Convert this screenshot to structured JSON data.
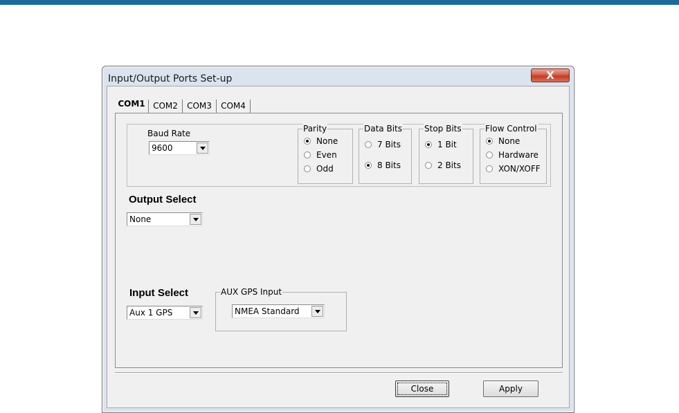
{
  "window": {
    "title": "Input/Output Ports Set-up",
    "close_glyph": "X"
  },
  "tabs": [
    {
      "label": "COM1",
      "active": true
    },
    {
      "label": "COM2",
      "active": false
    },
    {
      "label": "COM3",
      "active": false
    },
    {
      "label": "COM4",
      "active": false
    }
  ],
  "baud": {
    "label": "Baud Rate",
    "value": "9600"
  },
  "parity": {
    "legend": "Parity",
    "options": [
      "None",
      "Even",
      "Odd"
    ],
    "selected": "None"
  },
  "data_bits": {
    "legend": "Data Bits",
    "options": [
      "7 Bits",
      "8 Bits"
    ],
    "selected": "8 Bits"
  },
  "stop_bits": {
    "legend": "Stop Bits",
    "options": [
      "1 Bit",
      "2 Bits"
    ],
    "selected": "1 Bit"
  },
  "flow_control": {
    "legend": "Flow Control",
    "options": [
      "None",
      "Hardware",
      "XON/XOFF"
    ],
    "selected": "None"
  },
  "output_select": {
    "heading": "Output Select",
    "value": "None"
  },
  "input_select": {
    "heading": "Input Select",
    "value": "Aux 1 GPS"
  },
  "aux_gps": {
    "legend": "AUX GPS Input",
    "value": "NMEA Standard"
  },
  "buttons": {
    "close": "Close",
    "apply": "Apply"
  },
  "colors": {
    "topbar": "#1b6a9a",
    "close_button": "#c33b22",
    "dialog_face": "#f0f0f0"
  }
}
